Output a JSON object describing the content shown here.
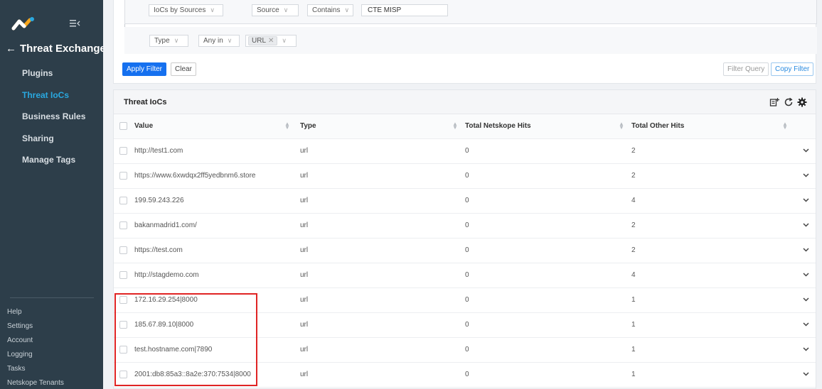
{
  "sidebar": {
    "back_label": "Threat Exchange",
    "nav": [
      {
        "label": "Plugins",
        "active": false
      },
      {
        "label": "Threat IoCs",
        "active": true
      },
      {
        "label": "Business Rules",
        "active": false
      },
      {
        "label": "Sharing",
        "active": false
      },
      {
        "label": "Manage Tags",
        "active": false
      }
    ],
    "links": [
      "Help",
      "Settings",
      "Account",
      "Logging",
      "Tasks",
      "Netskope Tenants"
    ]
  },
  "filter": {
    "row1": {
      "group": "IoCs by Sources",
      "field": "Source",
      "operator": "Contains",
      "value": "CTE MISP"
    },
    "row2": {
      "field": "Type",
      "operator": "Any in",
      "tag": "URL"
    },
    "apply_label": "Apply Filter",
    "clear_label": "Clear",
    "filter_query_label": "Filter Query",
    "copy_filter_label": "Copy Filter"
  },
  "table": {
    "title": "Threat IoCs",
    "columns": [
      "Value",
      "Type",
      "Total Netskope Hits",
      "Total Other Hits"
    ],
    "rows": [
      [
        "http://test1.com",
        "url",
        "0",
        "2"
      ],
      [
        "https://www.6xwdqx2ff5yedbnm6.store",
        "url",
        "0",
        "2"
      ],
      [
        "199.59.243.226",
        "url",
        "0",
        "4"
      ],
      [
        "bakanmadrid1.com/",
        "url",
        "0",
        "2"
      ],
      [
        "https://test.com",
        "url",
        "0",
        "2"
      ],
      [
        "http://stagdemo.com",
        "url",
        "0",
        "4"
      ],
      [
        "172.16.29.254|8000",
        "url",
        "0",
        "1"
      ],
      [
        "185.67.89.10|8000",
        "url",
        "0",
        "1"
      ],
      [
        "test.hostname.com|7890",
        "url",
        "0",
        "1"
      ],
      [
        "2001:db8:85a3::8a2e:370:7534|8000",
        "url",
        "0",
        "1"
      ]
    ]
  },
  "colors": {
    "sidebar_bg": "#2d3e4a",
    "accent": "#29a8e0",
    "primary": "#1570ef",
    "highlight": "#e02424"
  }
}
